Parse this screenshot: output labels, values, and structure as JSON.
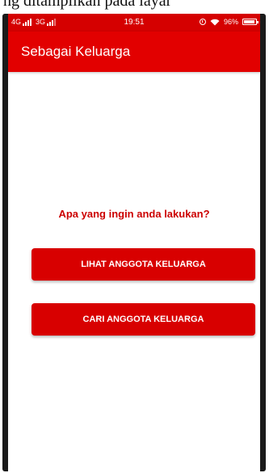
{
  "caption": "ng ditampilkan pada layar",
  "status_bar": {
    "network_1": "4G",
    "network_2": "3G",
    "time": "19:51",
    "battery_percent": "96%",
    "battery_level": 0.96
  },
  "app_bar": {
    "title": "Sebagai Keluarga"
  },
  "main": {
    "prompt": "Apa yang ingin anda lakukan?",
    "view_button_label": "LIHAT ANGGOTA KELUARGA",
    "search_button_label": "CARI ANGGOTA KELUARGA"
  },
  "colors": {
    "primary": "#e20000",
    "status_bar": "#d50000",
    "prompt_text": "#cc0000",
    "button": "#d80000"
  },
  "icons": {
    "signal": "signal-bars-icon",
    "alarm": "alarm-icon",
    "wifi": "wifi-icon",
    "battery": "battery-icon"
  }
}
